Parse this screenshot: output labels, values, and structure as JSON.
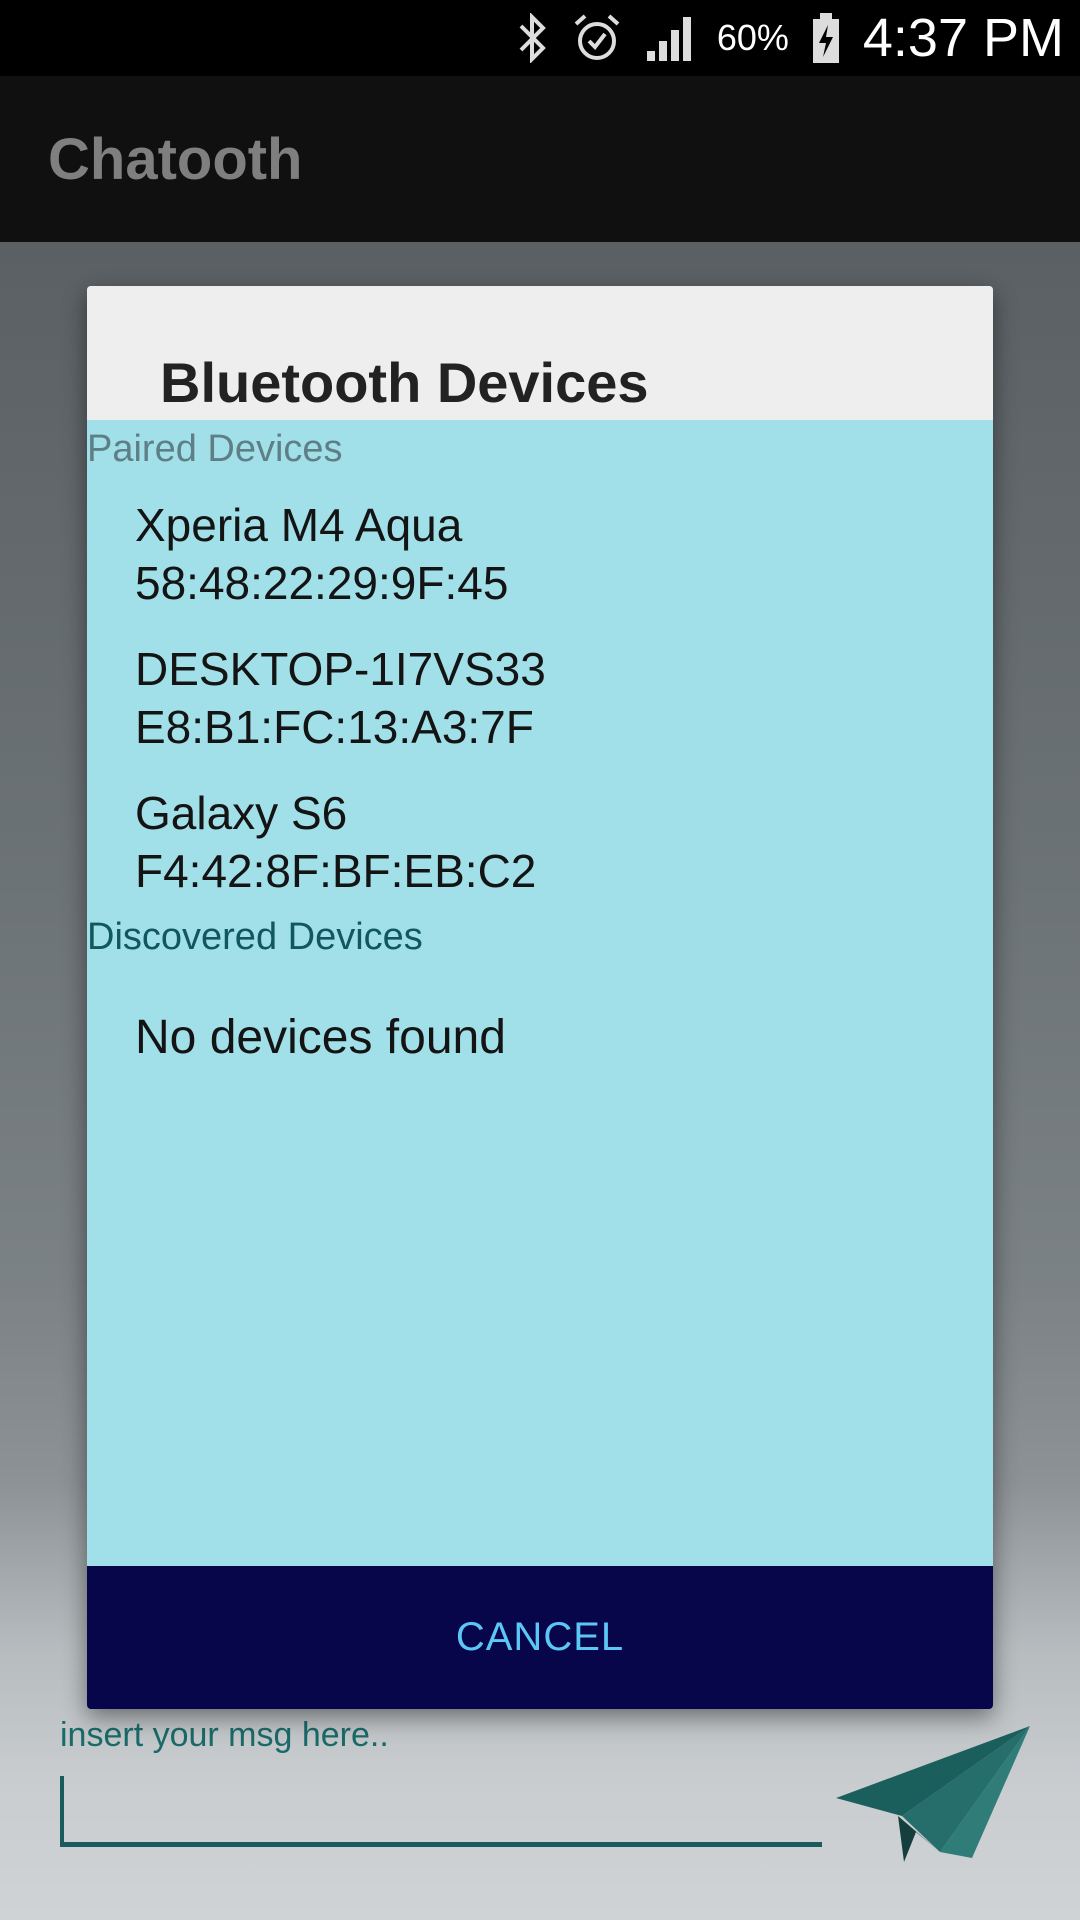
{
  "status_bar": {
    "battery": "60%",
    "time": "4:37 PM",
    "icons": [
      "bluetooth-icon",
      "alarm-icon",
      "signal-icon",
      "battery-charging-icon"
    ]
  },
  "app_bar": {
    "title": "Chatooth"
  },
  "dialog": {
    "title": "Bluetooth Devices",
    "paired_header": "Paired Devices",
    "paired": [
      {
        "name": "Xperia M4 Aqua",
        "address": "58:48:22:29:9F:45"
      },
      {
        "name": "DESKTOP-1I7VS33",
        "address": "E8:B1:FC:13:A3:7F"
      },
      {
        "name": "Galaxy S6",
        "address": "F4:42:8F:BF:EB:C2"
      }
    ],
    "discovered_header": "Discovered Devices",
    "discovered_empty": "No devices found",
    "cancel_label": "CANCEL"
  },
  "composer": {
    "placeholder": "insert your msg here..",
    "send_icon": "paper-plane-icon"
  },
  "colors": {
    "dialog_bg": "#a1e0e9",
    "footer_bg": "#07064a",
    "cancel_text": "#5cc6f5",
    "accent": "#1a5c5e"
  }
}
